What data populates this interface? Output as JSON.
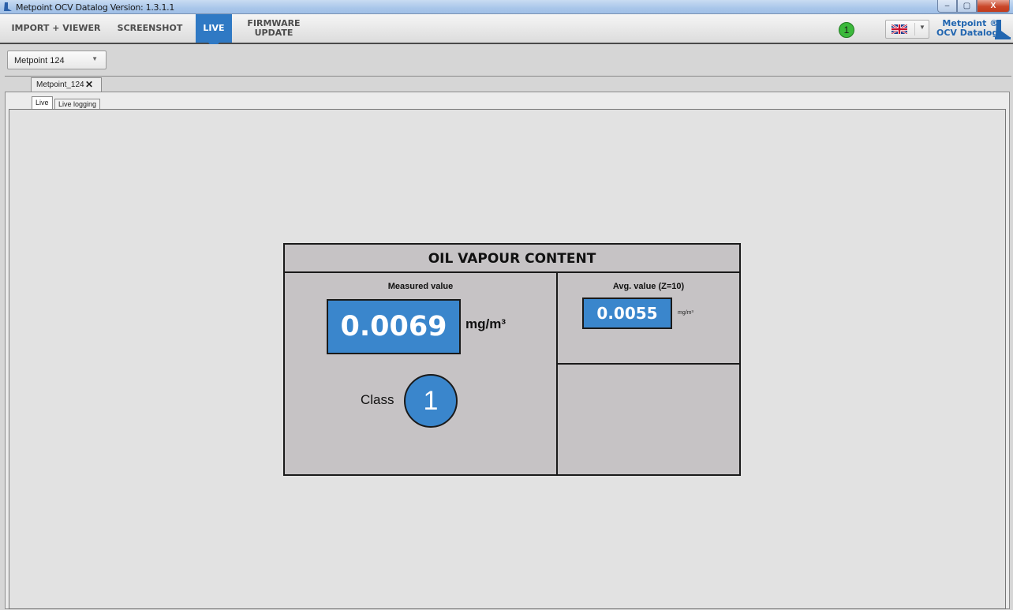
{
  "window": {
    "title": "Metpoint OCV Datalog Version: 1.3.1.1",
    "controls": {
      "minimize": "–",
      "maximize": "▢",
      "close": "X"
    }
  },
  "nav": {
    "items": [
      {
        "label": "IMPORT + VIEWER",
        "active": false
      },
      {
        "label": "SCREENSHOT",
        "active": false
      },
      {
        "label": "LIVE",
        "active": true
      },
      {
        "label": "FIRMWARE\nUPDATE",
        "active": false
      }
    ],
    "notification_count": "1",
    "language_flag": "uk-flag-icon",
    "brand_line1": "Metpoint ®",
    "brand_line2": "OCV Datalog"
  },
  "device_selector": {
    "value": "Metpoint 124"
  },
  "document_tab": {
    "label": "Metpoint_124",
    "close": "✕"
  },
  "sub_tabs": [
    {
      "label": "Live",
      "active": true
    },
    {
      "label": "Live logging",
      "active": false
    }
  ],
  "panel": {
    "title": "OIL VAPOUR CONTENT",
    "measured": {
      "label": "Measured value",
      "value": "0.0069",
      "unit": "mg/m³"
    },
    "class": {
      "label": "Class",
      "value": "1"
    },
    "average": {
      "label": "Avg. value (Z=10)",
      "value": "0.0055",
      "unit": "mg/m³"
    }
  },
  "colors": {
    "accent_blue": "#2f79c4",
    "value_blue": "#3a86cc",
    "notification_green": "#3cb93c",
    "brand_blue": "#2266b0"
  }
}
